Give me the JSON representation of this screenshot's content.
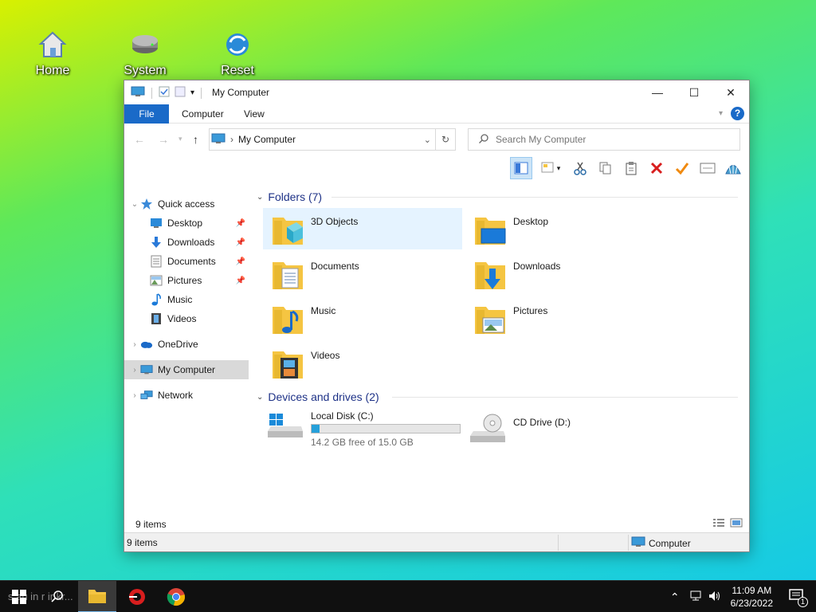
{
  "desktop": {
    "icons": [
      {
        "label": "Home"
      },
      {
        "label": "System"
      },
      {
        "label": "Reset"
      }
    ]
  },
  "window": {
    "title": "My Computer",
    "controls": {
      "minimize": "—",
      "maximize": "☐",
      "close": "✕"
    }
  },
  "ribbon": {
    "tabs": [
      {
        "label": "File"
      },
      {
        "label": "Computer"
      },
      {
        "label": "View"
      }
    ],
    "help": "?"
  },
  "address": {
    "path": "My Computer",
    "separator": "›"
  },
  "search": {
    "placeholder": "Search My Computer"
  },
  "nav": {
    "quick_access": "Quick access",
    "qa_items": [
      {
        "label": "Desktop",
        "icon": "desktop-icon"
      },
      {
        "label": "Downloads",
        "icon": "download-arrow-icon"
      },
      {
        "label": "Documents",
        "icon": "document-icon"
      },
      {
        "label": "Pictures",
        "icon": "picture-icon"
      },
      {
        "label": "Music",
        "icon": "music-note-icon"
      },
      {
        "label": "Videos",
        "icon": "film-icon"
      }
    ],
    "onedrive": "OneDrive",
    "my_computer": "My Computer",
    "network": "Network"
  },
  "content": {
    "folders_header": "Folders (7)",
    "folders": [
      {
        "label": "3D Objects"
      },
      {
        "label": "Desktop"
      },
      {
        "label": "Documents"
      },
      {
        "label": "Downloads"
      },
      {
        "label": "Music"
      },
      {
        "label": "Pictures"
      },
      {
        "label": "Videos"
      }
    ],
    "drives_header": "Devices and drives (2)",
    "drives": [
      {
        "label": "Local Disk (C:)",
        "free_text": "14.2 GB free of 15.0 GB",
        "used_fraction": 0.053
      },
      {
        "label": "CD Drive (D:)"
      }
    ]
  },
  "status": {
    "items_inner": "9 items",
    "items": "9 items",
    "location": "Computer"
  },
  "taskbar": {
    "ghost_text": "s.au in r ir kr...",
    "time": "11:09 AM",
    "date": "6/23/2022",
    "notification_count": "1"
  },
  "colors": {
    "accent": "#1a6ac8",
    "folder": "#f5c542",
    "progress": "#26a0da",
    "header_text": "#1e3287"
  }
}
